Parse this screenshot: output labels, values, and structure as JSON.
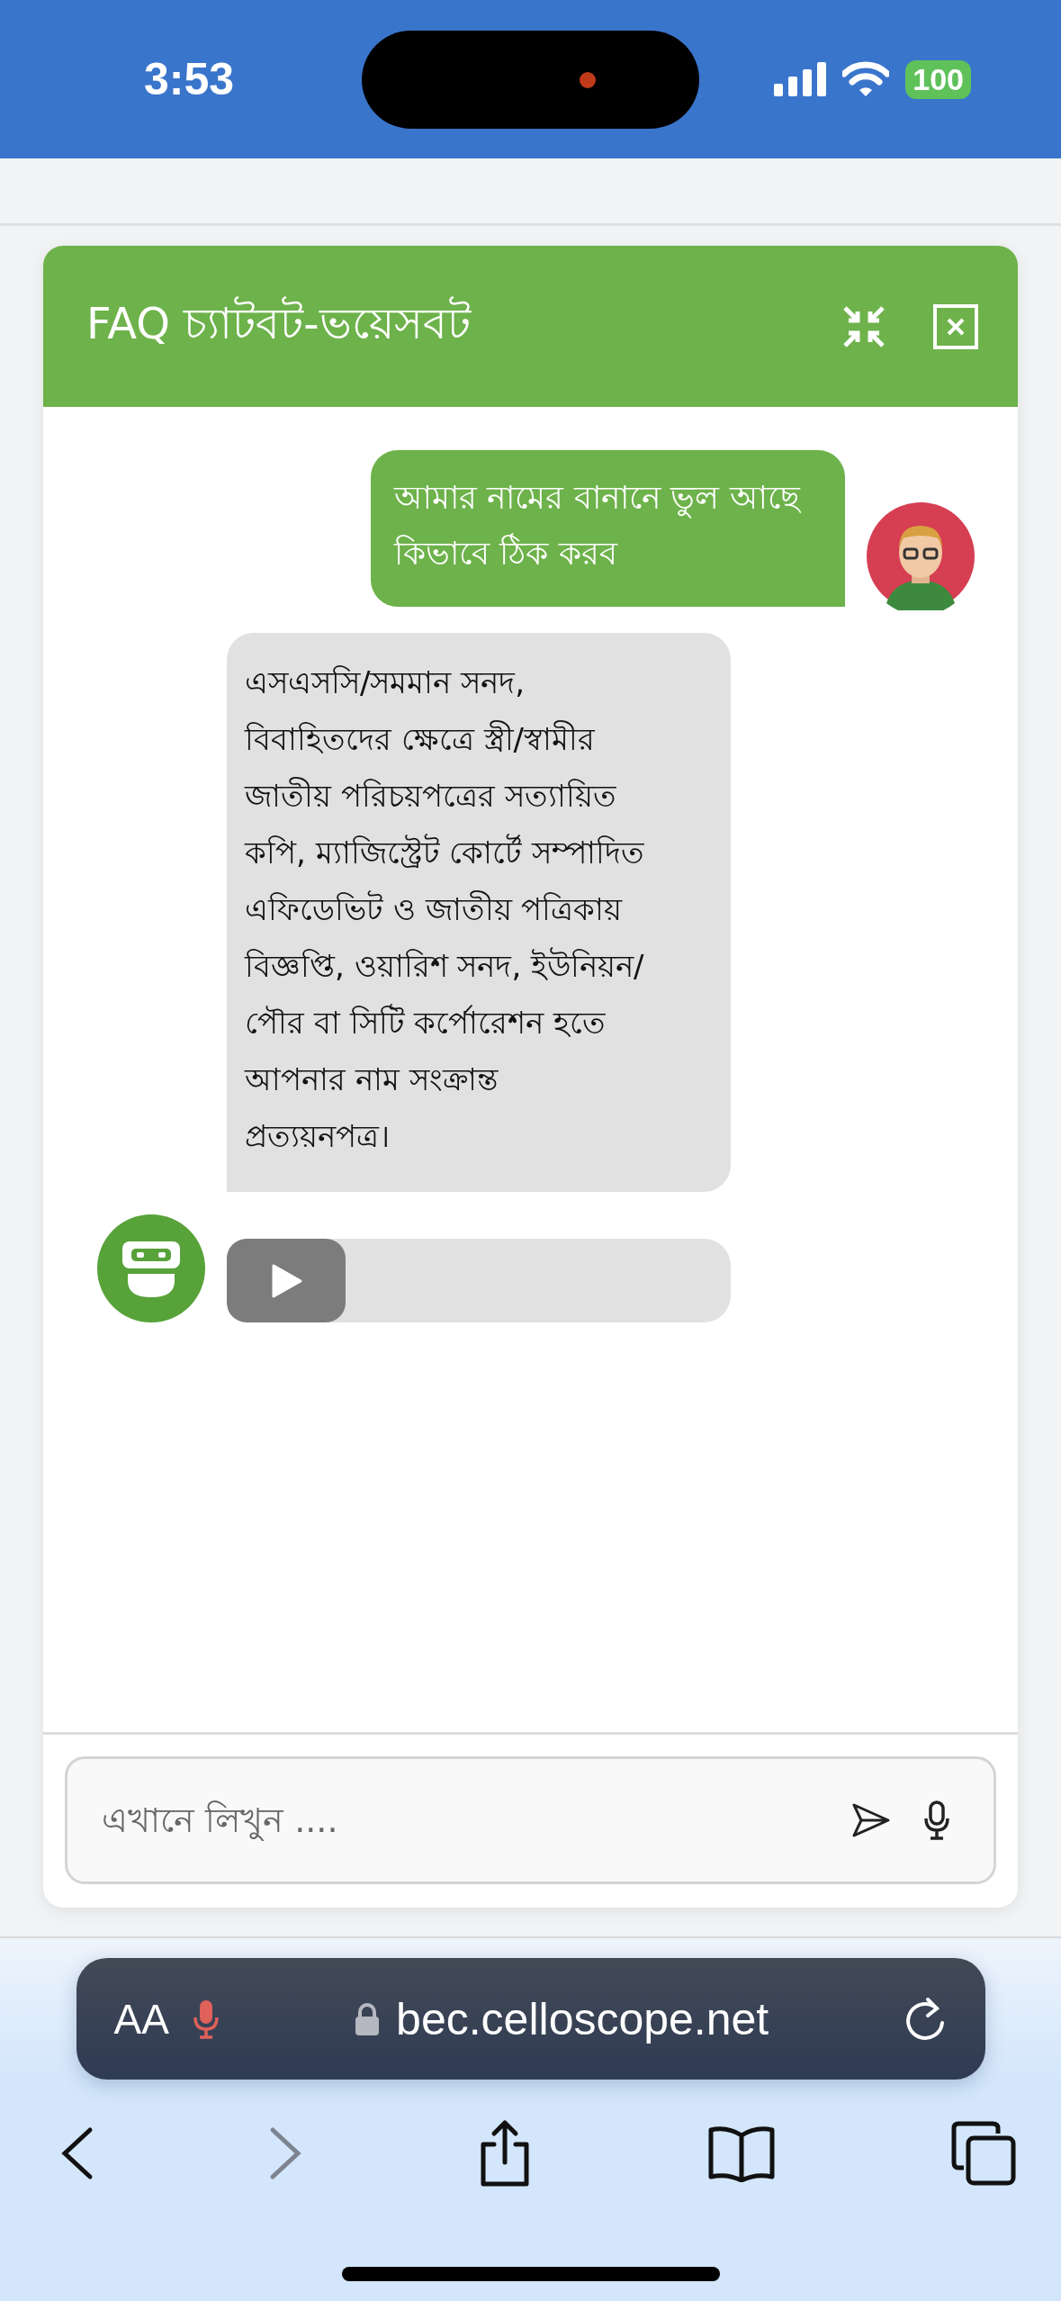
{
  "status_bar": {
    "time": "3:53",
    "battery": "100"
  },
  "chat": {
    "title": "FAQ চ্যাটবট-ভয়েসবট",
    "messages": [
      {
        "kind": "outgoing",
        "text": "আমার নামের বানানে ভুল আছে\nকিভাবে ঠিক করব"
      },
      {
        "kind": "incoming",
        "text": "এসএসসি/সমমান সনদ,\nবিবাহিতদের ক্ষেত্রে স্ত্রী/স্বামীর\nজাতীয় পরিচয়পত্রের সত্যায়িত\nকপি, ম্যাজিস্ট্রেট কোর্টে সম্পাদিত\nএফিডেভিট ও জাতীয় পত্রিকায়\nবিজ্ঞপ্তি, ওয়ারিশ সনদ, ইউনিয়ন/\nপৌর বা সিটি কর্পোরেশন হতে\nআপনার নাম সংক্রান্ত\nপ্রত্যয়নপত্র।"
      },
      {
        "kind": "audio"
      }
    ],
    "input": {
      "placeholder": "এখানে লিখুন ...."
    }
  },
  "browser": {
    "text_size_label": "AA",
    "url": "bec.celloscope.net"
  }
}
